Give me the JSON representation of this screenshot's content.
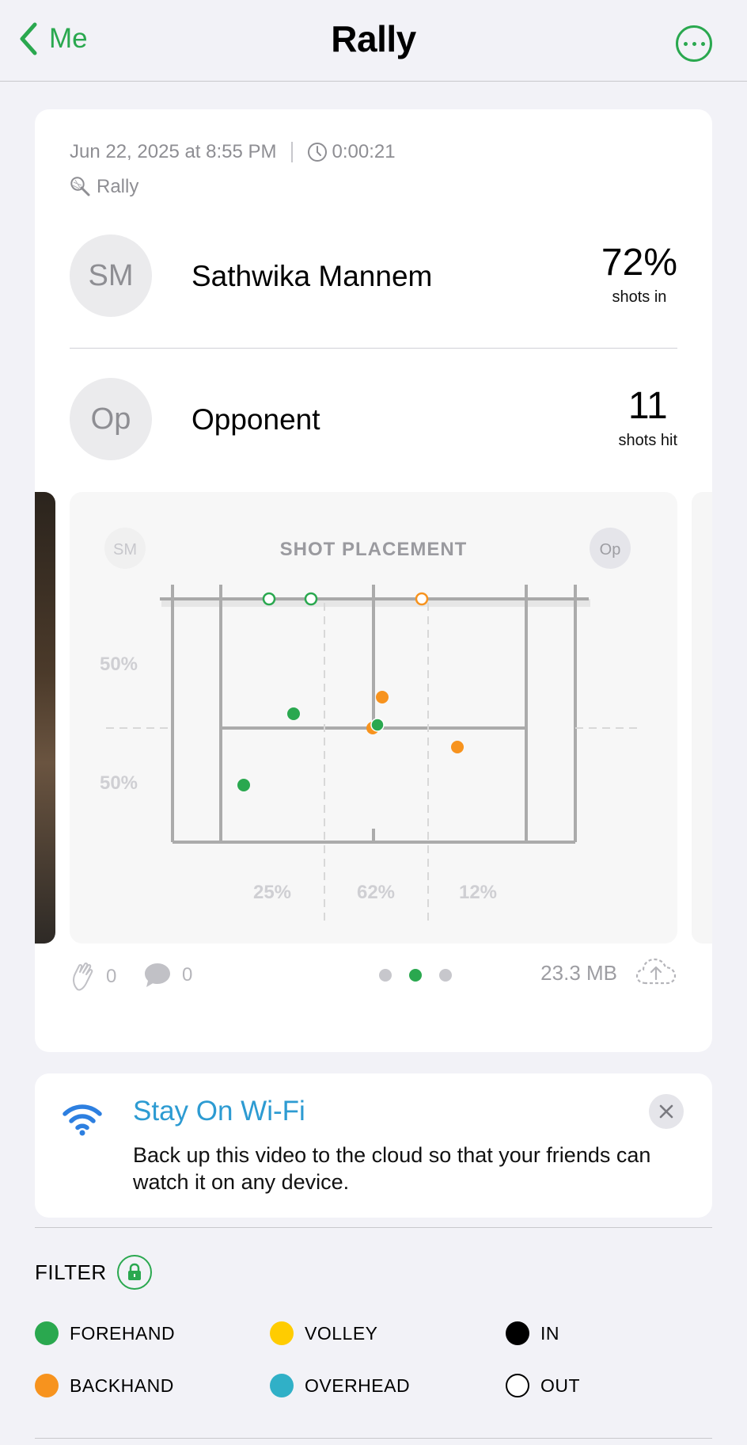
{
  "nav": {
    "back_label": "Me",
    "title": "Rally"
  },
  "session": {
    "datetime": "Jun 22, 2025 at 8:55 PM",
    "duration": "0:00:21",
    "sport_tag": "Rally"
  },
  "players": [
    {
      "initials": "SM",
      "name": "Sathwika Mannem",
      "stat_value": "72%",
      "stat_label": "shots in"
    },
    {
      "initials": "Op",
      "name": "Opponent",
      "stat_value": "11",
      "stat_label": "shots hit"
    }
  ],
  "shot_chart": {
    "title": "SHOT PLACEMENT",
    "left_player": "SM",
    "right_player": "Op",
    "depth_labels": [
      "50%",
      "50%"
    ],
    "zone_labels": [
      "25%",
      "62%",
      "12%"
    ],
    "colors": {
      "forehand": "#2aa84f",
      "backhand": "#f7931e"
    }
  },
  "footer": {
    "likes": "0",
    "comments": "0",
    "page_index": 1,
    "page_count": 3,
    "file_size": "23.3 MB"
  },
  "wifi_banner": {
    "title": "Stay On Wi-Fi",
    "body": "Back up this video to the cloud so that your friends can watch it on any device."
  },
  "filter": {
    "label": "FILTER",
    "items": [
      {
        "label": "FOREHAND",
        "color": "#2aa84f",
        "style": "filled"
      },
      {
        "label": "VOLLEY",
        "color": "#ffcc00",
        "style": "filled"
      },
      {
        "label": "IN",
        "color": "#000000",
        "style": "filled"
      },
      {
        "label": "BACKHAND",
        "color": "#f7931e",
        "style": "filled"
      },
      {
        "label": "OVERHEAD",
        "color": "#30b0c7",
        "style": "filled"
      },
      {
        "label": "OUT",
        "color": "#000000",
        "style": "outline"
      }
    ]
  }
}
